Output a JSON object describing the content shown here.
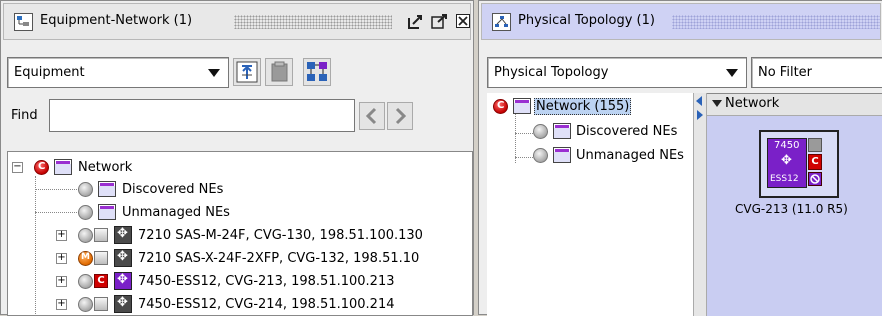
{
  "left_panel": {
    "title": "Equipment-Network (1)",
    "view_select": "Equipment",
    "find_label": "Find",
    "find_value": "",
    "tree": [
      {
        "label": "Network",
        "alarm": "critical"
      },
      {
        "label": "Discovered NEs"
      },
      {
        "label": "Unmanaged NEs"
      },
      {
        "label": "7210 SAS-M-24F, CVG-130, 198.51.100.130"
      },
      {
        "label": "7210 SAS-X-24F-2XFP, CVG-132, 198.51.10"
      },
      {
        "label": "7450-ESS12, CVG-213, 198.51.100.213"
      },
      {
        "label": "7450-ESS12, CVG-214, 198.51.100.214"
      }
    ]
  },
  "right_panel": {
    "title": "Physical Topology (1)",
    "view_select": "Physical Topology",
    "filter_select": "No Filter",
    "tree": [
      {
        "label": "Network (155)"
      },
      {
        "label": "Discovered NEs"
      },
      {
        "label": "Unmanaged NEs"
      }
    ],
    "map": {
      "header": "Network",
      "node": {
        "line1": "7450",
        "line2": "ESS12",
        "badge": "C",
        "label": "CVG-213 (11.0 R5)"
      }
    }
  },
  "colors": {
    "critical": "#c40000",
    "major": "#e06a00",
    "purple_node": "#7a20c8",
    "map_bg": "#c9cdf2"
  }
}
